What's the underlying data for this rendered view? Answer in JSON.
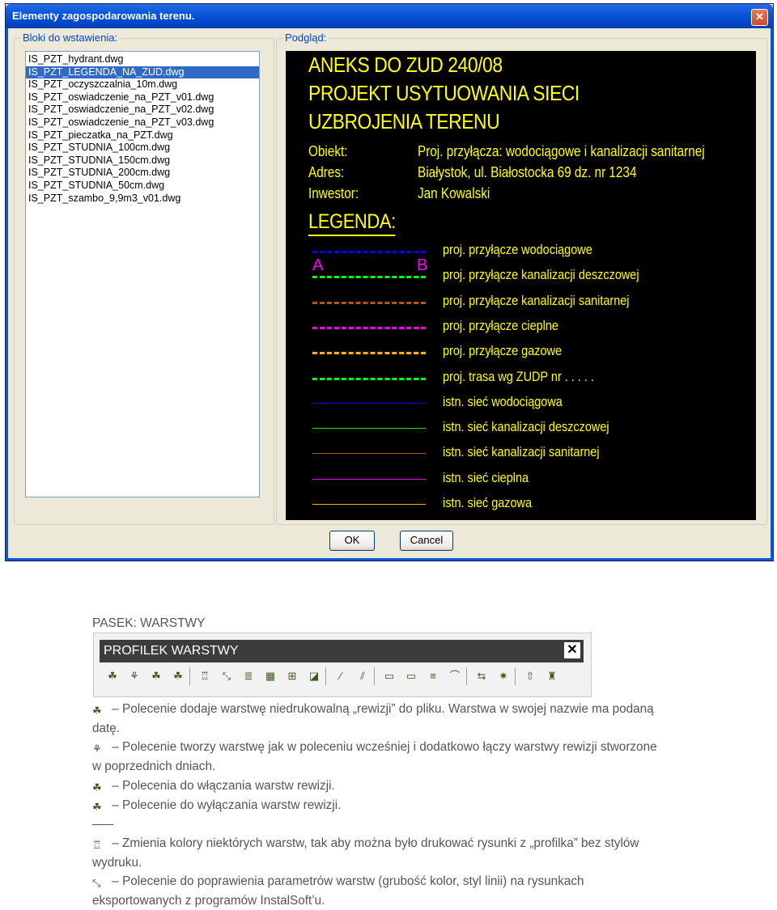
{
  "dialog": {
    "title": "Elementy zagospodarowania terenu.",
    "close_glyph": "✕",
    "blocks_label": "Bloki do wstawienia:",
    "preview_label": "Podgląd:",
    "items": [
      "IS_PZT_hydrant.dwg",
      "IS_PZT_LEGENDA_NA_ZUD.dwg",
      "IS_PZT_oczyszczalnia_10m.dwg",
      "IS_PZT_oswiadczenie_na_PZT_v01.dwg",
      "IS_PZT_oswiadczenie_na_PZT_v02.dwg",
      "IS_PZT_oswiadczenie_na_PZT_v03.dwg",
      "IS_PZT_pieczatka_na_PZT.dwg",
      "IS_PZT_STUDNIA_100cm.dwg",
      "IS_PZT_STUDNIA_150cm.dwg",
      "IS_PZT_STUDNIA_200cm.dwg",
      "IS_PZT_STUDNIA_50cm.dwg",
      "IS_PZT_szambo_9,9m3_v01.dwg"
    ],
    "selected_index": 1,
    "ok_label": "OK",
    "cancel_label": "Cancel"
  },
  "preview": {
    "title_lines": [
      "ANEKS DO ZUD 240/08",
      "PROJEKT USYTUOWANIA SIECI",
      "UZBROJENIA TERENU"
    ],
    "info": [
      {
        "key": "Obiekt:",
        "value": "Proj. przyłącza: wodociągowe i kanalizacji sanitarnej"
      },
      {
        "key": "Adres:",
        "value": "Białystok, ul. Białostocka 69 dz. nr 1234"
      },
      {
        "key": "Inwestor:",
        "value": "Jan Kowalski"
      }
    ],
    "legend_heading": "LEGENDA:",
    "marker_a": "A",
    "marker_b": "B",
    "legend": [
      {
        "label": "proj. przyłącze wodociągowe",
        "color": "#0000ff",
        "style": "dashed"
      },
      {
        "label": "proj. przyłącze kanalizacji deszczowej",
        "color": "#00ff00",
        "style": "dashed"
      },
      {
        "label": "proj. przyłącze kanalizacji sanitarnej",
        "color": "#b05a1a",
        "style": "dashed"
      },
      {
        "label": "proj. przyłącze cieplne",
        "color": "#ff00ff",
        "style": "dashed"
      },
      {
        "label": "proj. przyłącze gazowe",
        "color": "#ffb400",
        "style": "dashed"
      },
      {
        "label": "proj. trasa wg ZUDP nr . . . . .",
        "color": "#00ff00",
        "style": "dashed"
      },
      {
        "label": "istn. sieć wodociągowa",
        "color": "#0000ff",
        "style": "solid"
      },
      {
        "label": "istn. sieć kanalizacji deszczowej",
        "color": "#00ff00",
        "style": "solid"
      },
      {
        "label": "istn. sieć kanalizacji sanitarnej",
        "color": "#b05a1a",
        "style": "solid"
      },
      {
        "label": "istn. sieć cieplna",
        "color": "#ff00ff",
        "style": "solid"
      },
      {
        "label": "istn. sieć gazowa",
        "color": "#ffb400",
        "style": "solid"
      }
    ]
  },
  "doc": {
    "heading": "PASEK: WARSTWY",
    "toolbar_title": "PROFILEK WARSTWY",
    "toolbar_close": "✕",
    "toolbar_icons": [
      "revision-layer-icon",
      "revision-merge-icon",
      "layers-on-icon",
      "layers-off-icon",
      "layer-colors-icon",
      "layer-fix-icon",
      "text-layer-icon",
      "hatch-layer-icon",
      "dimension-layer-icon",
      "layer-frame-icon",
      "pipe-layer-icon",
      "pipe-hatch-icon",
      "pb-layer-icon",
      "gm-layer-icon",
      "ground-layer-icon",
      "level-layer-icon",
      "layer-move-icon",
      "layer-explode-icon",
      "layer-export-icon",
      "layer-clean-icon"
    ],
    "paragraphs": [
      {
        "icon": "revision-layer-icon",
        "text": "– Polecenie dodaje warstwę niedrukowalną „rewizji” do pliku. Warstwa w swojej nazwie ma podaną datę."
      },
      {
        "icon": "revision-merge-icon",
        "text": "– Polecenie tworzy warstwę jak w poleceniu wcześniej i dodatkowo łączy warstwy rewizji stworzone w poprzednich dniach."
      },
      {
        "icon": "layers-on-icon",
        "text": "– Polecenia do włączania warstw rewizji."
      },
      {
        "icon": "layers-off-icon",
        "text": "– Polecenie do wyłączania warstw rewizji."
      },
      {
        "icon": "layer-colors-icon",
        "text": "– Zmienia kolory niektórych warstw, tak aby można było drukować rysunki z „profilka” bez stylów wydruku."
      },
      {
        "icon": "layer-fix-icon",
        "text": "– Polecenie do poprawienia parametrów warstw (grubość kolor, styl linii) na rysunkach eksportowanych z programów InstalSoft’u."
      }
    ]
  }
}
